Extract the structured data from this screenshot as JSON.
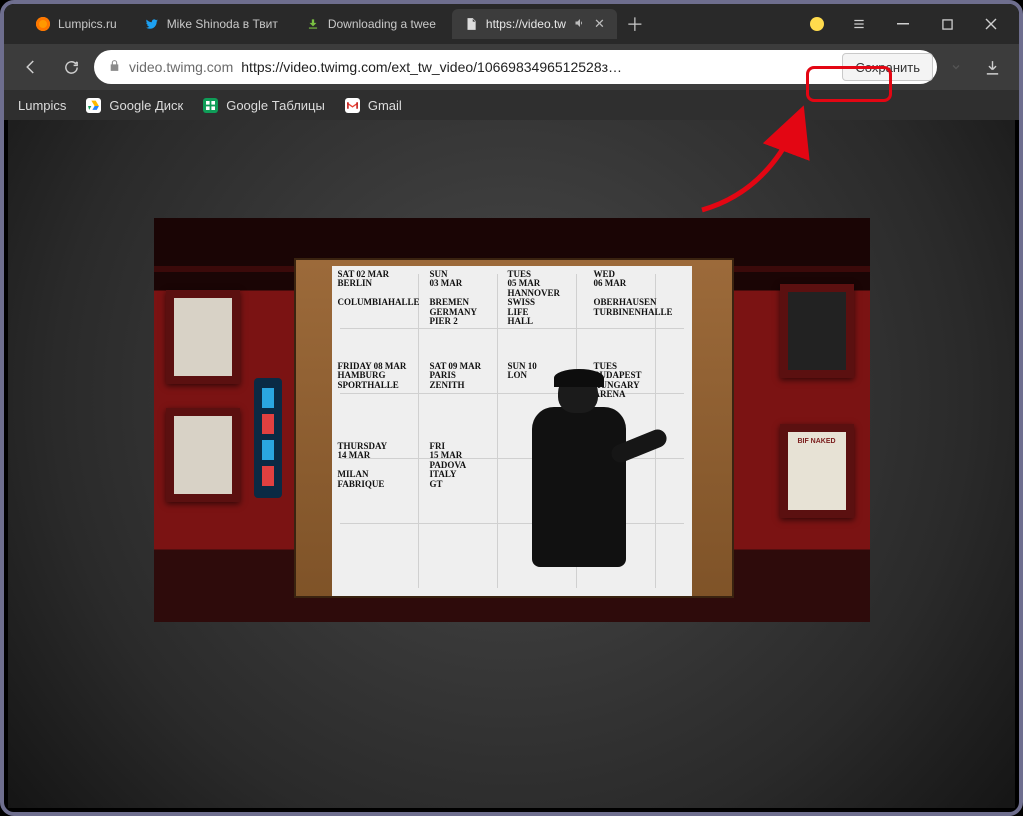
{
  "tabs": [
    {
      "title": "Lumpics.ru"
    },
    {
      "title": "Mike Shinoda в Твит"
    },
    {
      "title": "Downloading a twee"
    },
    {
      "title": "https://video.tw"
    }
  ],
  "toolbar": {
    "host": "video.twimg.com",
    "url": "https://video.twimg.com/ext_tw_video/1066983496512528з…",
    "save_label": "Сохранить"
  },
  "bookmarks": {
    "b0": "Lumpics",
    "b1": "Google Диск",
    "b2": "Google Таблицы",
    "b3": "Gmail"
  },
  "scene": {
    "cells": [
      "SAT 02 MAR\nBERLIN\n\nCOLUMBIAHALLE",
      "SUN\n03 MAR\n\nBREMEN\nGERMANY\nPIER 2",
      "TUES\n05 MAR\nHANNOVER\nSWISS\nLIFE\nHALL",
      "WED\n06 MAR\n\nOBERHAUSEN\nTURBINENHALLE",
      "FRIDAY 08 MAR\nHAMBURG\nSPORTHALLE",
      "SAT 09 MAR\nPARIS\nZENITH",
      "SUN 10\nLON",
      "TUES\nBUDAPEST\nHUNGARY\nARENA",
      "THURSDAY\n14 MAR\n\nMILAN\nFABRIQUE",
      "FRI\n15 MAR\nPADOVA\nITALY\nGT"
    ],
    "poster4": "BIF\nNAKED"
  }
}
